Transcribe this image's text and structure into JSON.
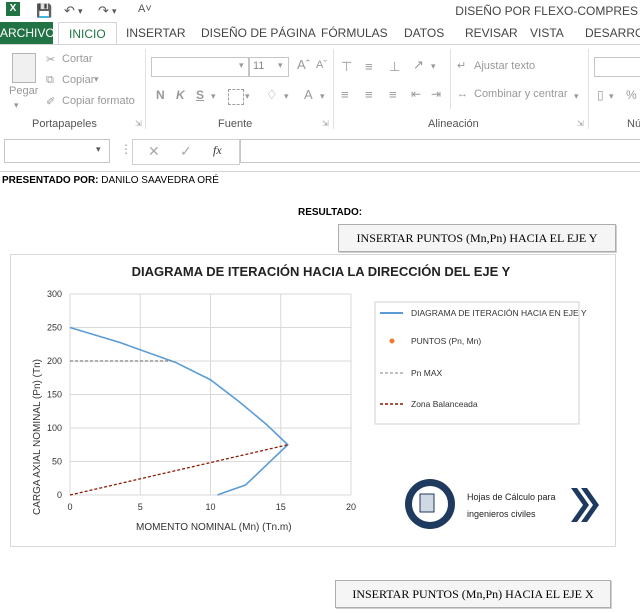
{
  "window": {
    "title": "DISEÑO POR FLEXO-COMPRES"
  },
  "tabs": [
    "ARCHIVO",
    "INICIO",
    "INSERTAR",
    "DISEÑO DE PÁGINA",
    "FÓRMULAS",
    "DATOS",
    "REVISAR",
    "VISTA",
    "DESARROLL"
  ],
  "ribbon": {
    "clipboard": {
      "paste": "Pegar",
      "cut": "Cortar",
      "copy": "Copiar",
      "format_painter": "Copiar formato",
      "group": "Portapapeles"
    },
    "font": {
      "size": "11",
      "bold": "N",
      "italic": "K",
      "underline": "S",
      "group": "Fuente"
    },
    "alignment": {
      "wrap": "Ajustar texto",
      "merge": "Combinar y centrar",
      "group": "Alineación"
    },
    "number": {
      "group": "Nú"
    }
  },
  "formula_bar": {
    "fx": "fx"
  },
  "sheet": {
    "presented_label": "PRESENTADO POR:",
    "presented_name": "DANILO SAAVEDRA ORÉ",
    "result_label": "RESULTADO:",
    "button_y": "INSERTAR PUNTOS (Mn,Pn) HACIA EL EJE Y",
    "button_x": "INSERTAR PUNTOS (Mn,Pn) HACIA EL EJE X",
    "logo_text_1": "Hojas de Cálculo para",
    "logo_text_2": "ingenieros civiles"
  },
  "colors": {
    "excel_green": "#217346",
    "curve": "#5b9bd5",
    "points": "#ed7d31",
    "pnmax": "#7f7f7f",
    "balanced": "#8b1a00"
  },
  "chart_data": {
    "type": "line",
    "title": "DIAGRAMA DE ITERACIÓN HACIA LA DIRECCIÓN DEL EJE Y",
    "xlabel": "MOMENTO NOMINAL (Mn) (Tn.m)",
    "ylabel": "CARGA AXIAL NOMINAL (Pn) (Tn)",
    "xlim": [
      0,
      20
    ],
    "ylim": [
      0,
      300
    ],
    "xticks": [
      0,
      5,
      10,
      15,
      20
    ],
    "yticks": [
      0,
      50,
      100,
      150,
      200,
      250,
      300
    ],
    "grid": true,
    "legend_position": "right",
    "series": [
      {
        "name": "DIAGRAMA DE ITERACIÓN HACIA EN EJE Y",
        "style": "solid",
        "color": "#5b9bd5",
        "x": [
          0,
          3.5,
          7.5,
          10,
          12,
          14,
          15.5,
          14,
          12.5,
          11,
          10.5
        ],
        "y": [
          250,
          228,
          198,
          172,
          140,
          105,
          75,
          45,
          15,
          4,
          0
        ]
      },
      {
        "name": "PUNTOS (Pn, Mn)",
        "style": "marker",
        "color": "#ed7d31",
        "x": [],
        "y": []
      },
      {
        "name": "Pn MAX",
        "style": "dashed",
        "color": "#7f7f7f",
        "x": [
          0,
          7.2
        ],
        "y": [
          200,
          200
        ]
      },
      {
        "name": "Zona Balanceada",
        "style": "dashed",
        "color": "#8b1a00",
        "x": [
          0,
          15.5
        ],
        "y": [
          0,
          75
        ]
      }
    ]
  }
}
